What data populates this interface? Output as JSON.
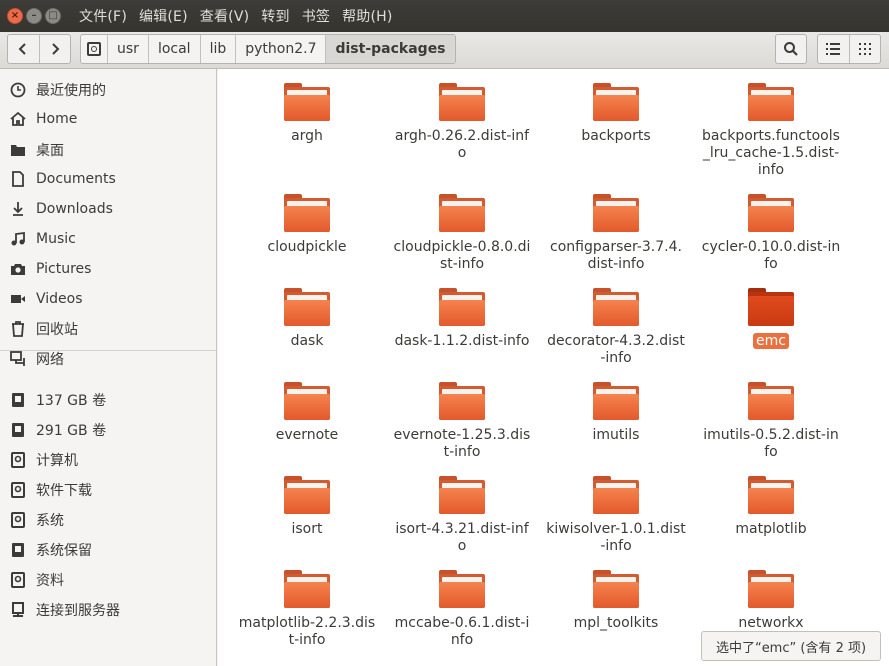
{
  "menu": {
    "file": "文件(F)",
    "edit": "编辑(E)",
    "view": "查看(V)",
    "go": "转到",
    "bookmarks": "书签",
    "help": "帮助(H)"
  },
  "window_buttons": {
    "close": "×",
    "minimize": "–",
    "maximize": "□"
  },
  "nav": {
    "back": "‹",
    "forward": "›"
  },
  "breadcrumbs": [
    {
      "label": "usr"
    },
    {
      "label": "local"
    },
    {
      "label": "lib"
    },
    {
      "label": "python2.7"
    },
    {
      "label": "dist-packages"
    }
  ],
  "sidebar": {
    "items": [
      {
        "label": "最近使用的",
        "icon": "clock-icon"
      },
      {
        "label": "Home",
        "icon": "home-icon"
      },
      {
        "label": "桌面",
        "icon": "desktop-folder-icon"
      },
      {
        "label": "Documents",
        "icon": "document-icon"
      },
      {
        "label": "Downloads",
        "icon": "download-icon"
      },
      {
        "label": "Music",
        "icon": "music-icon"
      },
      {
        "label": "Pictures",
        "icon": "camera-icon"
      },
      {
        "label": "Videos",
        "icon": "video-icon"
      },
      {
        "label": "回收站",
        "icon": "trash-icon"
      },
      {
        "label": "网络",
        "icon": "network-icon"
      },
      {
        "label": "137 GB 卷",
        "icon": "drive-icon"
      },
      {
        "label": "291 GB 卷",
        "icon": "drive-icon"
      },
      {
        "label": "计算机",
        "icon": "computer-disk-icon"
      },
      {
        "label": "软件下载",
        "icon": "disk-icon"
      },
      {
        "label": "系统",
        "icon": "disk-icon"
      },
      {
        "label": "系统保留",
        "icon": "drive-icon"
      },
      {
        "label": "资料",
        "icon": "disk-icon"
      },
      {
        "label": "连接到服务器",
        "icon": "server-icon"
      }
    ]
  },
  "files": [
    {
      "name": "argh"
    },
    {
      "name": "argh-0.26.2.dist-info"
    },
    {
      "name": "backports"
    },
    {
      "name": "backports.functools_lru_cache-1.5.dist-info"
    },
    {
      "name": "cloudpickle"
    },
    {
      "name": "cloudpickle-0.8.0.dist-info"
    },
    {
      "name": "configparser-3.7.4.dist-info"
    },
    {
      "name": "cycler-0.10.0.dist-info"
    },
    {
      "name": "dask"
    },
    {
      "name": "dask-1.1.2.dist-info"
    },
    {
      "name": "decorator-4.3.2.dist-info"
    },
    {
      "name": "emc",
      "selected": true
    },
    {
      "name": "evernote"
    },
    {
      "name": "evernote-1.25.3.dist-info"
    },
    {
      "name": "imutils"
    },
    {
      "name": "imutils-0.5.2.dist-info"
    },
    {
      "name": "isort"
    },
    {
      "name": "isort-4.3.21.dist-info"
    },
    {
      "name": "kiwisolver-1.0.1.dist-info"
    },
    {
      "name": "matplotlib"
    },
    {
      "name": "matplotlib-2.2.3.dist-info"
    },
    {
      "name": "mccabe-0.6.1.dist-info"
    },
    {
      "name": "mpl_toolkits"
    },
    {
      "name": "networkx"
    }
  ],
  "status": {
    "text": "选中了“emc” (含有 2 项)"
  },
  "colors": {
    "accent": "#e9703f",
    "folder": "#f07a48",
    "titlebar": "#3d3c38"
  }
}
